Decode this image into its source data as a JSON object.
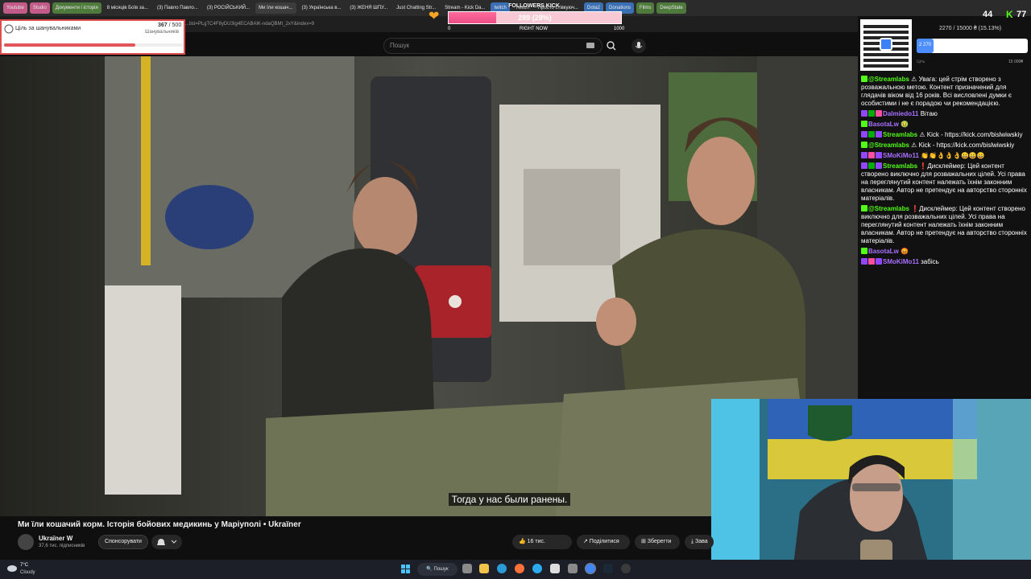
{
  "tabs": [
    {
      "label": "Youtube",
      "style": "pill"
    },
    {
      "label": "Studio",
      "style": "pill"
    },
    {
      "label": "Документи і історія",
      "style": "green"
    },
    {
      "label": "8 місяців Боїв за...",
      "style": "plain"
    },
    {
      "label": "(3) Павло Павло...",
      "style": "plain"
    },
    {
      "label": "(3) РОСІЙСЬКИЙ...",
      "style": "plain"
    },
    {
      "label": "Ми їли кошач...",
      "style": "active"
    },
    {
      "label": "(3) Українська в...",
      "style": "plain"
    },
    {
      "label": "(3) ЖЕНЯ ШПУ...",
      "style": "plain"
    },
    {
      "label": "Just Chatting Str...",
      "style": "plain"
    },
    {
      "label": "Stream - Kick Da...",
      "style": "plain"
    },
    {
      "label": "twitch",
      "style": "blue"
    },
    {
      "label": "Twitch",
      "style": "plain"
    },
    {
      "label": "Просто стівкуюч...",
      "style": "plain"
    },
    {
      "label": "Dota2",
      "style": "blue"
    },
    {
      "label": "Donations",
      "style": "blue"
    },
    {
      "label": "Films",
      "style": "green"
    },
    {
      "label": "DeepState",
      "style": "green"
    }
  ],
  "address": {
    "text": "...list=PLgTC4F8yDU3Ig4ECABAlK-ndaQBMt_2xY&index=9"
  },
  "search": {
    "placeholder": "Пошук"
  },
  "goal": {
    "title": "Ціль за шанувальниками",
    "current": "367",
    "total": "/ 500",
    "sub": "Шанувальників",
    "progress": 0.734
  },
  "followers": {
    "title": "FOLLOWERS KICK",
    "value": "289 (28%)",
    "min": "0",
    "now": "RIGHT NOW",
    "max": "1000",
    "progress": 0.28
  },
  "stats": {
    "viewers": "44",
    "kick_count": "77"
  },
  "donation": {
    "text": "2270 / 15000 ₴ (15.13%)",
    "fill_label": "2 270",
    "label": "Ціль",
    "max": "15 000₴",
    "progress": 0.1513
  },
  "chat": [
    {
      "badges": [
        "kick"
      ],
      "user": "@Streamlabs",
      "color": "green",
      "text": "⚠ Увага: цей стрім створено з розважальною метою. Контент призначений для глядачів віком від 16 років. Всі висловлені думки є особистими і не є порадою чи рекомендацією."
    },
    {
      "badges": [
        "tw",
        "mod",
        "sub"
      ],
      "user": "Dalmiedo11",
      "color": "purple",
      "text": "Вітаю"
    },
    {
      "badges": [
        "kick"
      ],
      "user": "BasotaLw",
      "color": "purple",
      "text": "🤢"
    },
    {
      "badges": [
        "tw",
        "mod",
        "tw"
      ],
      "user": "Streamlabs",
      "color": "green",
      "text": "⚠ Kick - https://kick.com/bislwiwskiy"
    },
    {
      "badges": [
        "kick"
      ],
      "user": "@Streamlabs",
      "color": "green",
      "text": "⚠ Kick - https://kick.com/bislwiwskiy"
    },
    {
      "badges": [
        "tw",
        "sub",
        "tw"
      ],
      "user": "SMoKiMo11",
      "color": "purple",
      "text": "👏👏👌👌👌😀😀😀"
    },
    {
      "badges": [
        "tw",
        "mod",
        "tw"
      ],
      "user": "Streamlabs",
      "color": "green",
      "text": "❗Дисклеймер: Цей контент створено виключно для розважальних цілей. Усі права на переглянутий контент належать їхнім законним власникам. Автор не претендує на авторство сторонніх матеріалів."
    },
    {
      "badges": [
        "kick"
      ],
      "user": "@Streamlabs",
      "color": "green",
      "text": "❗Дисклеймер: Цей контент створено виключно для розважальних цілей. Усі права на переглянутий контент належать їхнім законним власникам. Автор не претендує на авторство сторонніх матеріалів."
    },
    {
      "badges": [
        "kick"
      ],
      "user": "BasotaLw",
      "color": "purple",
      "text": "😡"
    },
    {
      "badges": [
        "tw",
        "sub",
        "tw"
      ],
      "user": "SMoKiMo11",
      "color": "purple",
      "text": "забісь"
    }
  ],
  "video": {
    "subtitle": "Тогда у нас были ранены.",
    "title": "Ми їли кошачий корм. Історія бойових медикинь у Маріуполі • Ukraїner",
    "channel": "Ukraїner W",
    "subs": "37,6 тис. підписників",
    "sponsor": "Спонсорувати",
    "likes": "👍 16 тис.",
    "share": "↗ Поділитися",
    "save": "⊞ Зберегти",
    "download": "⤓ Зава"
  },
  "taskbar": {
    "temp": "7°C",
    "weather": "Cloudy",
    "search": "🔍 Пошук"
  },
  "colors": {
    "accent_red": "#e14c4c",
    "kick_green": "#53fc18",
    "twitch_purple": "#9146ff",
    "donation_blue": "#4c8dff",
    "follower_pink": "#e94e86"
  }
}
